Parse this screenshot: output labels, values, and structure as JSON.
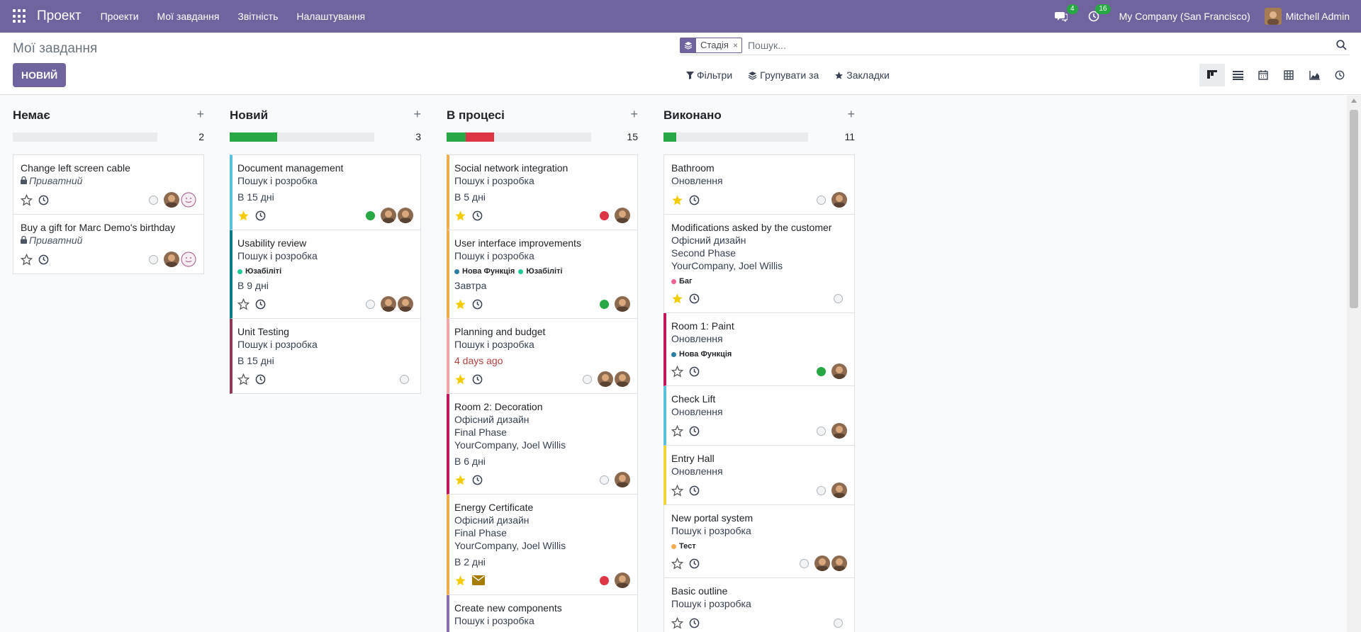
{
  "navbar": {
    "brand": "Проект",
    "menu": [
      "Проекти",
      "Мої завдання",
      "Звітність",
      "Налаштування"
    ],
    "messages_badge": "4",
    "activities_badge": "16",
    "company": "My Company (San Francisco)",
    "user": "Mitchell Admin"
  },
  "control": {
    "breadcrumb": "Мої завдання",
    "new_button": "НОВИЙ",
    "facet_label": "Стадія",
    "facet_remove": "×",
    "search_placeholder": "Пошук...",
    "filters": "Фільтри",
    "group_by": "Групувати за",
    "favorites": "Закладки"
  },
  "columns": [
    {
      "title": "Немає",
      "count": "2",
      "progress": [],
      "cards": [
        {
          "title": "Change left screen cable",
          "private": "Приватний",
          "star": false,
          "dot": "empty",
          "avatars": 2
        },
        {
          "title": "Buy a gift for Marc Demo's birthday",
          "private": "Приватний",
          "star": false,
          "dot": "empty",
          "avatars": 2
        }
      ]
    },
    {
      "title": "Новий",
      "count": "3",
      "progress": [
        {
          "color": "#28a745",
          "pct": 33
        }
      ],
      "cards": [
        {
          "title": "Document management",
          "lines": [
            "Пошук і розробка"
          ],
          "deadline": "В 15 днi",
          "star": true,
          "dot": "green",
          "avatars": 2,
          "bar": "#5bc0de"
        },
        {
          "title": "Usability review",
          "lines": [
            "Пошук і розробка"
          ],
          "tags": [
            {
              "label": "Юзабіліті",
              "color": "#20c997"
            }
          ],
          "deadline": "В 9 днi",
          "star": false,
          "dot": "empty",
          "avatars": 2,
          "bar": "#0e7c86"
        },
        {
          "title": "Unit Testing",
          "lines": [
            "Пошук і розробка"
          ],
          "deadline": "В 15 днi",
          "star": false,
          "dot": "empty",
          "avatars": 0,
          "bar": "#8e3a59"
        }
      ]
    },
    {
      "title": "В процесі",
      "count": "15",
      "progress": [
        {
          "color": "#28a745",
          "pct": 13
        },
        {
          "color": "#dc3545",
          "pct": 20
        }
      ],
      "cards": [
        {
          "title": "Social network integration",
          "lines": [
            "Пошук і розробка"
          ],
          "deadline": "В 5 днi",
          "star": true,
          "dot": "red",
          "avatars": 1,
          "bar": "#f0ad4e"
        },
        {
          "title": "User interface improvements",
          "lines": [
            "Пошук і розробка"
          ],
          "tags": [
            {
              "label": "Нова Функція",
              "color": "#2c7ea1"
            },
            {
              "label": "Юзабіліті",
              "color": "#20c997"
            }
          ],
          "deadline": "Завтра",
          "star": true,
          "dot": "green",
          "avatars": 1,
          "bar": "#f0ad4e"
        },
        {
          "title": "Planning and budget",
          "lines": [
            "Пошук і розробка"
          ],
          "deadline": "4 days ago",
          "late": true,
          "star": true,
          "dot": "empty",
          "avatars": 2,
          "bar": "#f4a6a6"
        },
        {
          "title": "Room 2: Decoration",
          "lines": [
            "Офісний дизайн",
            "Final Phase",
            "YourCompany, Joel Willis"
          ],
          "deadline": "В 6 днi",
          "star": true,
          "dot": "empty",
          "avatars": 1,
          "bar": "#c2185b"
        },
        {
          "title": "Energy Certificate",
          "lines": [
            "Офісний дизайн",
            "Final Phase",
            "YourCompany, Joel Willis"
          ],
          "deadline": "В 2 днi",
          "star": true,
          "dot": "red",
          "avatars": 1,
          "bar": "#f0ad4e",
          "mail": true
        },
        {
          "title": "Create new components",
          "lines": [
            "Пошук і розробка"
          ],
          "star": false,
          "dot": "empty",
          "avatars": 0,
          "bar": "#8a6fb5"
        }
      ]
    },
    {
      "title": "Виконано",
      "count": "11",
      "progress": [
        {
          "color": "#28a745",
          "pct": 9
        }
      ],
      "cards": [
        {
          "title": "Bathroom",
          "lines": [
            "Оновлення"
          ],
          "star": true,
          "dot": "empty",
          "avatars": 1
        },
        {
          "title": "Modifications asked by the customer",
          "lines": [
            "Офісний дизайн",
            "Second Phase",
            "YourCompany, Joel Willis"
          ],
          "tags": [
            {
              "label": "Баг",
              "color": "#f06292"
            }
          ],
          "star": true,
          "dot": "empty",
          "avatars": 0
        },
        {
          "title": "Room 1: Paint",
          "lines": [
            "Оновлення"
          ],
          "tags": [
            {
              "label": "Нова Функція",
              "color": "#2c7ea1"
            }
          ],
          "star": false,
          "dot": "green",
          "avatars": 1,
          "bar": "#c2185b"
        },
        {
          "title": "Check Lift",
          "lines": [
            "Оновлення"
          ],
          "star": false,
          "dot": "empty",
          "avatars": 1,
          "bar": "#5bc0de"
        },
        {
          "title": "Entry Hall",
          "lines": [
            "Оновлення"
          ],
          "star": false,
          "dot": "empty",
          "avatars": 1,
          "bar": "#f0d43a"
        },
        {
          "title": "New portal system",
          "lines": [
            "Пошук і розробка"
          ],
          "tags": [
            {
              "label": "Тест",
              "color": "#f0ad4e"
            }
          ],
          "star": false,
          "dot": "empty",
          "avatars": 2
        },
        {
          "title": "Basic outline",
          "lines": [
            "Пошук і розробка"
          ],
          "star": false,
          "dot": "empty",
          "avatars": 0
        }
      ]
    }
  ]
}
